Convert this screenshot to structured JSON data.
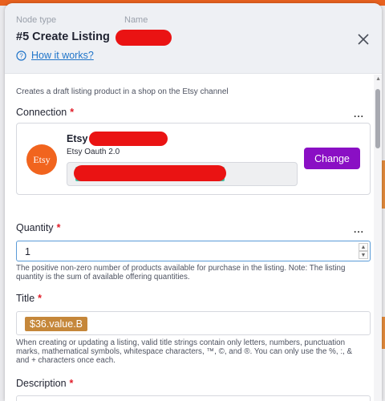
{
  "header": {
    "node_type_label": "Node type",
    "name_label": "Name",
    "title": "#5 Create Listing",
    "how_it_works": "How it works?"
  },
  "description": "Creates a draft listing product in a shop on the Etsy channel",
  "connection": {
    "label": "Connection",
    "required_mark": "*",
    "more": "...",
    "logo_text": "Etsy",
    "name": "Etsy /",
    "auth_type": "Etsy Oauth 2.0",
    "change_label": "Change"
  },
  "quantity": {
    "label": "Quantity",
    "required_mark": "*",
    "more": "...",
    "value": "1",
    "hint": "The positive non-zero number of products available for purchase in the listing. Note: The listing quantity is the sum of available offering quantities."
  },
  "title_field": {
    "label": "Title",
    "required_mark": "*",
    "pill_value": "$36.value.B",
    "hint": "When creating or updating a listing, valid title strings contain only letters, numbers, punctuation marks, mathematical symbols, whitespace characters, ™, ©, and ®. You can only use the %, :, & and + characters once each."
  },
  "description_field": {
    "label": "Description",
    "required_mark": "*"
  },
  "colors": {
    "accent_orange": "#e8611f",
    "etsy_orange": "#f1641e",
    "change_purple": "#8a0fc4",
    "link_blue": "#1f74c9",
    "required_red": "#e11d29",
    "pill_brown": "#c5873a"
  }
}
